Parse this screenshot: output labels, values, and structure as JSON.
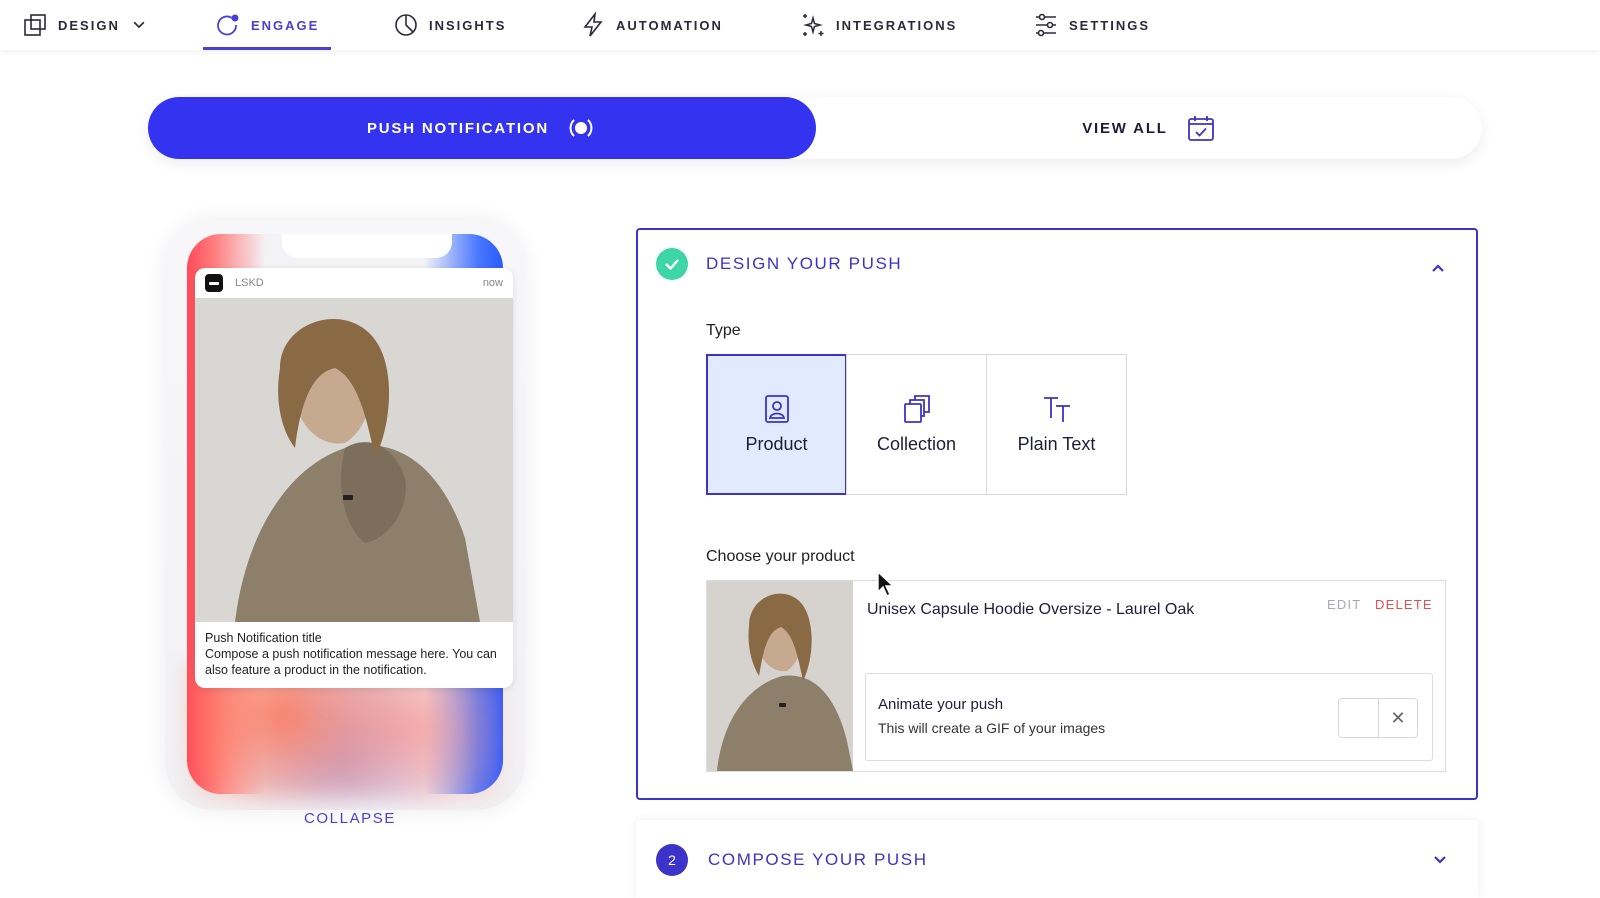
{
  "nav": {
    "items": [
      {
        "label": "DESIGN",
        "icon": "design-icon",
        "has_dropdown": true
      },
      {
        "label": "ENGAGE",
        "icon": "engage-icon",
        "active": true
      },
      {
        "label": "INSIGHTS",
        "icon": "insights-icon"
      },
      {
        "label": "AUTOMATION",
        "icon": "lightning-icon"
      },
      {
        "label": "INTEGRATIONS",
        "icon": "sparkles-icon"
      },
      {
        "label": "SETTINGS",
        "icon": "sliders-icon"
      }
    ]
  },
  "toggle": {
    "push_label": "PUSH NOTIFICATION",
    "view_all_label": "VIEW ALL"
  },
  "preview": {
    "app_name": "LSKD",
    "time": "now",
    "title": "Push Notification title",
    "message": "Compose a push notification message here. You can also feature a product in the notification.",
    "collapse_label": "COLLAPSE"
  },
  "design": {
    "title": "DESIGN YOUR PUSH",
    "type_label": "Type",
    "types": [
      {
        "label": "Product",
        "icon": "product-icon",
        "selected": true
      },
      {
        "label": "Collection",
        "icon": "collection-icon",
        "selected": false
      },
      {
        "label": "Plain Text",
        "icon": "text-icon",
        "selected": false
      }
    ],
    "choose_label": "Choose your product",
    "product_name": "Unisex Capsule Hoodie Oversize - Laurel Oak",
    "edit_label": "EDIT",
    "delete_label": "DELETE",
    "animate_title": "Animate your push",
    "animate_sub": "This will create a GIF of your images",
    "animate_enabled": false
  },
  "compose": {
    "number": "2",
    "title": "COMPOSE YOUR PUSH"
  },
  "colors": {
    "accent": "#3434f0",
    "brand": "#3d33c8",
    "success": "#3fd6a6",
    "danger": "#e0504f"
  }
}
